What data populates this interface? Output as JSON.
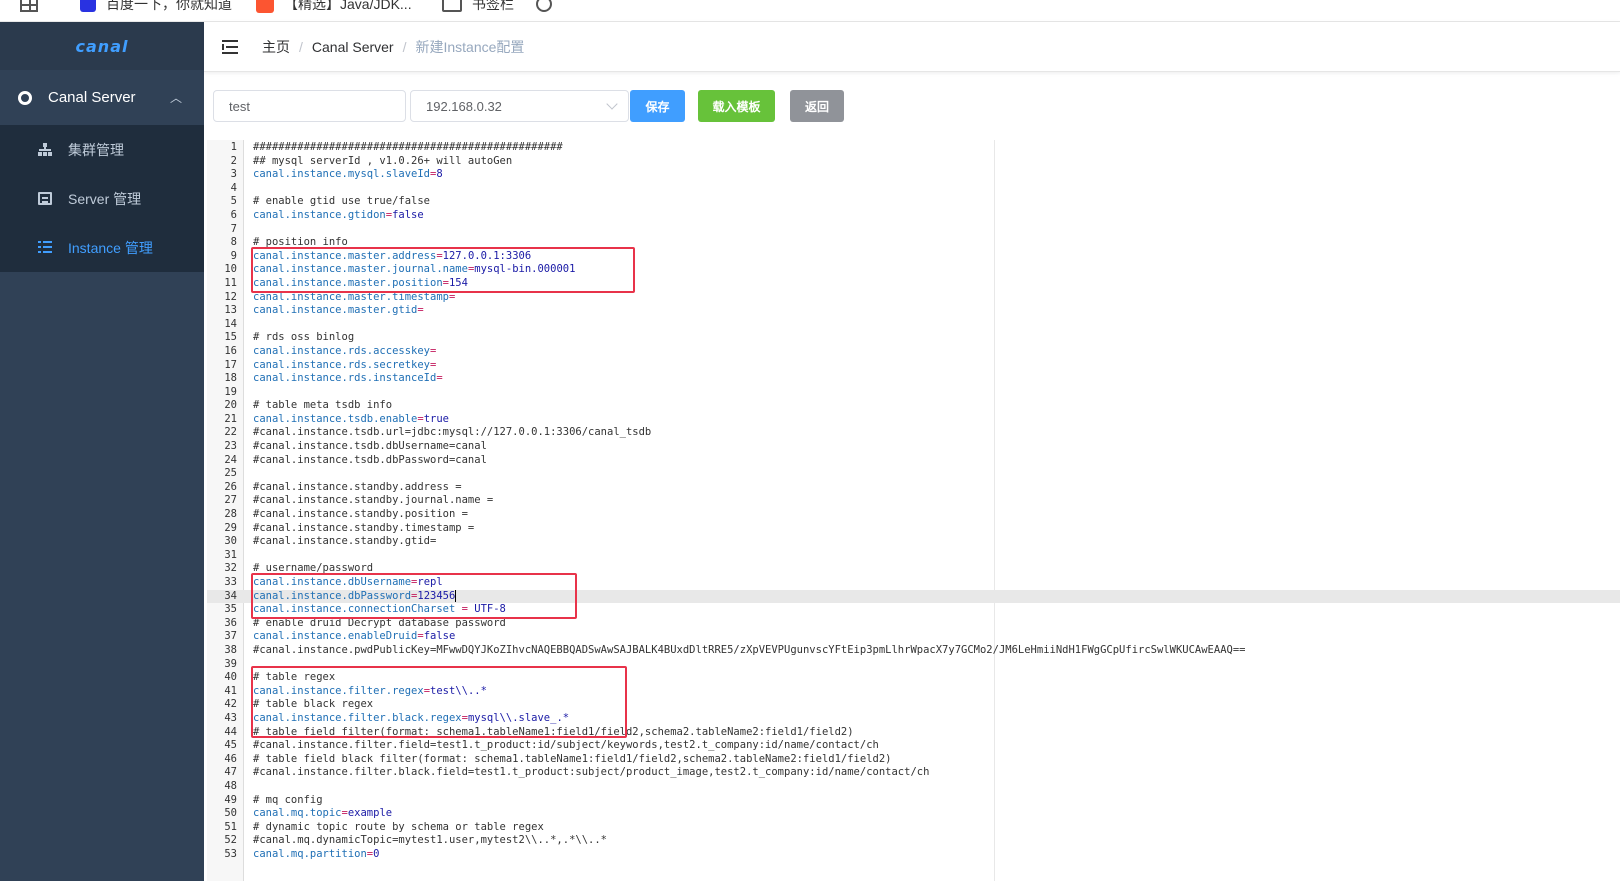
{
  "browser": {
    "bookmarks": [
      {
        "label": "",
        "icon": "apps-icon"
      },
      {
        "label": "百度一下，你就知道",
        "icon": "baidu-icon"
      },
      {
        "label": "【精选】Java/JDK...",
        "icon": "csdn-icon"
      },
      {
        "label": "书签栏",
        "icon": "folder-icon"
      },
      {
        "label": "",
        "icon": "help-icon"
      }
    ]
  },
  "sidebar": {
    "logo": "canal",
    "group_label": "Canal Server",
    "items": [
      {
        "label": "集群管理",
        "icon": "cluster-icon"
      },
      {
        "label": "Server 管理",
        "icon": "server-icon"
      },
      {
        "label": "Instance 管理",
        "icon": "instance-icon"
      }
    ]
  },
  "header": {
    "breadcrumb": [
      "主页",
      "Canal Server",
      "新建Instance配置"
    ]
  },
  "toolbar": {
    "name_value": "test",
    "server_value": "192.168.0.32",
    "save_label": "保存",
    "load_template_label": "载入模板",
    "back_label": "返回"
  },
  "colors": {
    "primary": "#409eff",
    "success": "#67c23a",
    "info": "#909399",
    "sidebar_bg": "#304156",
    "highlight_box": "#e8334a"
  },
  "editor": {
    "current_line": 34,
    "lines": [
      "#################################################",
      "## mysql serverId , v1.0.26+ will autoGen",
      "canal.instance.mysql.slaveId=8",
      "",
      "# enable gtid use true/false",
      "canal.instance.gtidon=false",
      "",
      "# position info",
      "canal.instance.master.address=127.0.0.1:3306",
      "canal.instance.master.journal.name=mysql-bin.000001",
      "canal.instance.master.position=154",
      "canal.instance.master.timestamp=",
      "canal.instance.master.gtid=",
      "",
      "# rds oss binlog",
      "canal.instance.rds.accesskey=",
      "canal.instance.rds.secretkey=",
      "canal.instance.rds.instanceId=",
      "",
      "# table meta tsdb info",
      "canal.instance.tsdb.enable=true",
      "#canal.instance.tsdb.url=jdbc:mysql://127.0.0.1:3306/canal_tsdb",
      "#canal.instance.tsdb.dbUsername=canal",
      "#canal.instance.tsdb.dbPassword=canal",
      "",
      "#canal.instance.standby.address =",
      "#canal.instance.standby.journal.name =",
      "#canal.instance.standby.position =",
      "#canal.instance.standby.timestamp =",
      "#canal.instance.standby.gtid=",
      "",
      "# username/password",
      "canal.instance.dbUsername=repl",
      "canal.instance.dbPassword=123456",
      "canal.instance.connectionCharset = UTF-8",
      "# enable druid Decrypt database password",
      "canal.instance.enableDruid=false",
      "#canal.instance.pwdPublicKey=MFwwDQYJKoZIhvcNAQEBBQADSwAwSAJBALK4BUxdDltRRE5/zXpVEVPUgunvscYFtEip3pmLlhrWpacX7y7GCMo2/JM6LeHmiiNdH1FWgGCpUfircSwlWKUCAwEAAQ==",
      "",
      "# table regex",
      "canal.instance.filter.regex=test\\\\..*",
      "# table black regex",
      "canal.instance.filter.black.regex=mysql\\\\.slave_.*",
      "# table field filter(format: schema1.tableName1:field1/field2,schema2.tableName2:field1/field2)",
      "#canal.instance.filter.field=test1.t_product:id/subject/keywords,test2.t_company:id/name/contact/ch",
      "# table field black filter(format: schema1.tableName1:field1/field2,schema2.tableName2:field1/field2)",
      "#canal.instance.filter.black.field=test1.t_product:subject/product_image,test2.t_company:id/name/contact/ch",
      "",
      "# mq config",
      "canal.mq.topic=example",
      "# dynamic topic route by schema or table regex",
      "#canal.mq.dynamicTopic=mytest1.user,mytest2\\\\..*,.*\\\\..*",
      "canal.mq.partition=0"
    ]
  }
}
